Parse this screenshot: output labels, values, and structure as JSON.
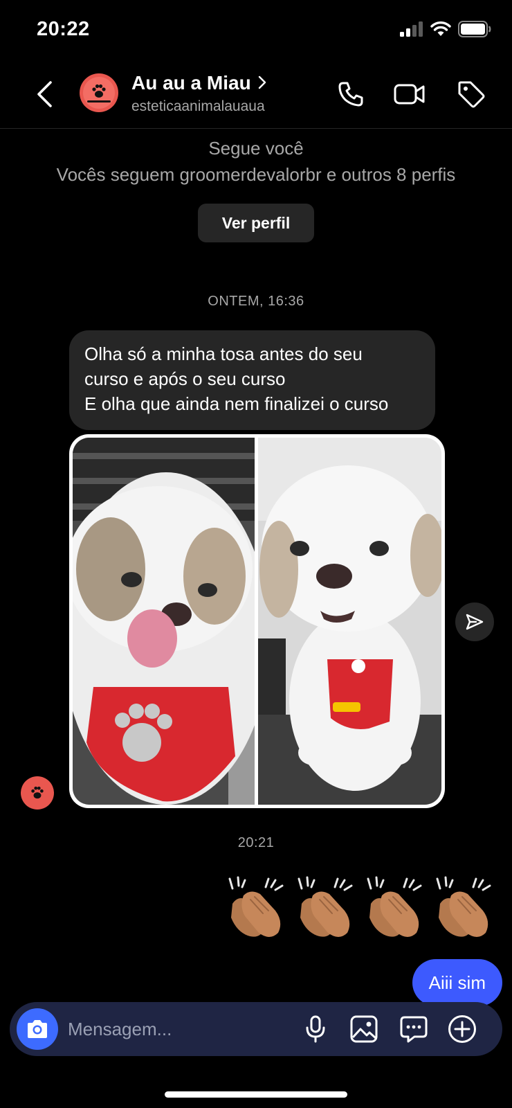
{
  "status_bar": {
    "time": "20:22"
  },
  "header": {
    "contact_name": "Au au a Miau",
    "username": "esteticaanimalauaua"
  },
  "profile_info": {
    "follows_you": "Segue você",
    "mutual_followers": "Vocês seguem groomerdevalorbr e outros 8 perfis",
    "view_profile_label": "Ver perfil"
  },
  "messages": {
    "timestamp_1": "ONTEM, 16:36",
    "incoming_text": [
      "Olha só a minha tosa antes do seu",
      "curso e após o seu curso",
      "E olha que ainda nem finalizei o curso"
    ],
    "timestamp_2": "20:21",
    "clap_reactions": [
      "👏🏽",
      "👏🏽",
      "👏🏽",
      "👏🏽"
    ],
    "outgoing_text": "Aiii sim"
  },
  "composer": {
    "placeholder": "Mensagem..."
  },
  "colors": {
    "background": "#000000",
    "incoming_bubble": "#262626",
    "outgoing_bubble": "#3d5afe",
    "composer_bg": "#1f2544",
    "camera_button": "#3d6bff",
    "avatar": "#e9574f"
  }
}
